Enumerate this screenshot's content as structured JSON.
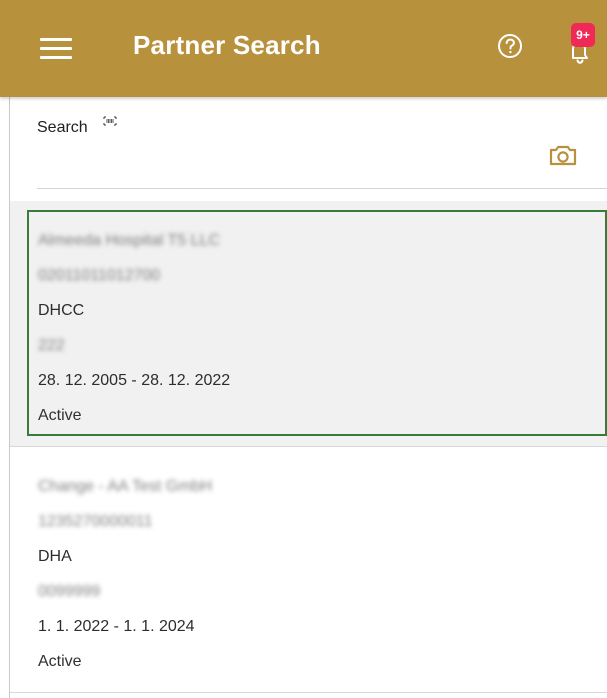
{
  "header": {
    "title": "Partner Search",
    "notification_badge": "9+",
    "background_color": "#b8913d",
    "icons": {
      "menu": "menu-icon",
      "help": "help-icon",
      "notifications": "bell-icon"
    }
  },
  "search": {
    "label": "Search",
    "placeholder": "",
    "value": "",
    "icons": {
      "barcode": "barcode-icon",
      "camera": "camera-icon"
    }
  },
  "results": [
    {
      "selected": true,
      "name": "Almeeda Hospital T5 LLC",
      "partner_id": "02011011012700",
      "partner_type": "DHCC",
      "code": "222",
      "date_range": "28. 12. 2005 - 28. 12. 2022",
      "status": "Active"
    },
    {
      "selected": false,
      "name": "Change - AA Test GmbH",
      "partner_id": "1235270000011",
      "partner_type": "DHA",
      "code": "0099999",
      "date_range": "1. 1. 2022 - 1. 1. 2024",
      "status": "Active"
    }
  ],
  "colors": {
    "accent": "#b8913d",
    "selection_border": "#3b7b3a",
    "notification": "#f02a57"
  }
}
